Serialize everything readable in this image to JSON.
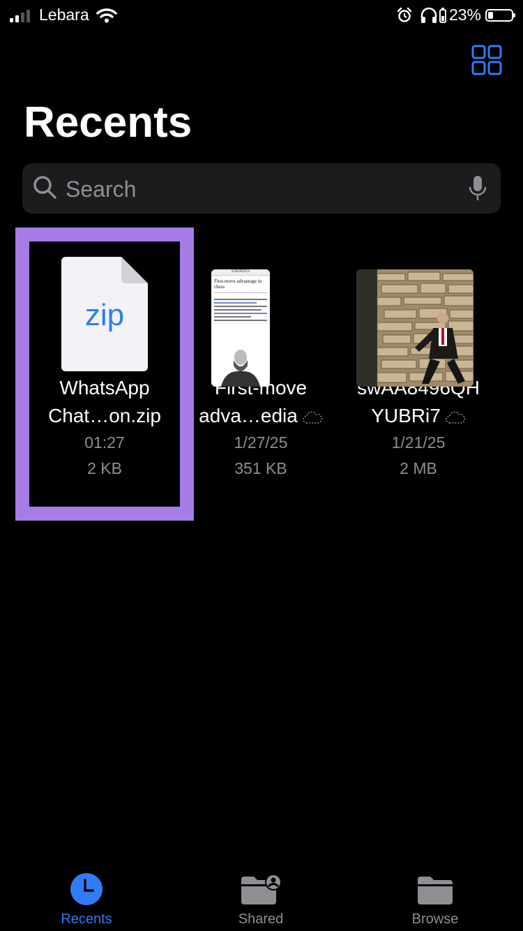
{
  "status_bar": {
    "carrier": "Lebara",
    "battery_percent": "23%",
    "battery_level": 0.23
  },
  "header": {
    "title": "Recents",
    "view_toggle_icon": "grid-view-icon"
  },
  "search": {
    "placeholder": "Search",
    "value": ""
  },
  "files": [
    {
      "name_line1": "WhatsApp",
      "name_line2": "Chat…on.zip",
      "date": "01:27",
      "size": "2 KB",
      "selected": true,
      "thumbnail_label": "zip",
      "icloud": false
    },
    {
      "name_line1": "First-move",
      "name_line2": "adva…edia",
      "date": "1/27/25",
      "size": "351 KB",
      "selected": false,
      "icloud": true,
      "thumbnail": {
        "site": "WIKIPEDIA",
        "heading": "First-move advantage in chess"
      }
    },
    {
      "name_line1": "swAA8496QH",
      "name_line2": "YUBRi7",
      "date": "1/21/25",
      "size": "2 MB",
      "selected": false,
      "icloud": true
    }
  ],
  "tab_bar": {
    "tabs": [
      {
        "label": "Recents",
        "icon": "clock-icon",
        "active": true
      },
      {
        "label": "Shared",
        "icon": "shared-folder-icon",
        "active": false
      },
      {
        "label": "Browse",
        "icon": "folder-icon",
        "active": false
      }
    ]
  },
  "colors": {
    "accent": "#2f7cf6",
    "selection": "#a67ce6",
    "secondary_text": "#8e8e93",
    "inactive_tab": "#8e8e93"
  }
}
